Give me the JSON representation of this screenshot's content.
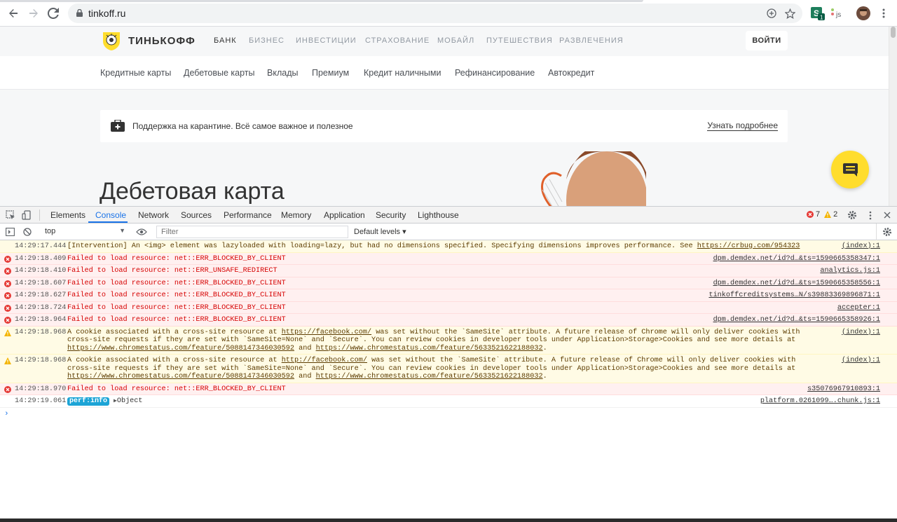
{
  "browser": {
    "url": "tinkoff.ru",
    "back_icon": "arrow-left-icon",
    "forward_icon": "arrow-right-icon",
    "reload_icon": "reload-icon",
    "extension_badge": "1",
    "extension_js_label": "js"
  },
  "site": {
    "brand": "ТИНЬКОФФ",
    "top_nav": [
      "БАНК",
      "БИЗНЕС",
      "ИНВЕСТИЦИИ",
      "СТРАХОВАНИЕ",
      "МОБАЙЛ",
      "ПУТЕШЕСТВИЯ",
      "РАЗВЛЕЧЕНИЯ"
    ],
    "login_label": "ВОЙТИ",
    "sub_nav": [
      "Кредитные карты",
      "Дебетовые карты",
      "Вклады",
      "Премиум",
      "Кредит наличными",
      "Рефинансирование",
      "Автокредит"
    ],
    "promo_text": "Поддержка на карантине. Всё самое важное и полезное",
    "promo_link": "Узнать подробнее",
    "heading": "Дебетовая карта",
    "accent_color": "#ffdd2d"
  },
  "devtools": {
    "tabs": [
      "Elements",
      "Console",
      "Network",
      "Sources",
      "Performance",
      "Memory",
      "Application",
      "Security",
      "Lighthouse"
    ],
    "active_tab": "Console",
    "error_count": "7",
    "warning_count": "2",
    "context": "top",
    "filter_placeholder": "Filter",
    "levels_label": "Default levels ▾",
    "messages": [
      {
        "type": "warn",
        "time": "14:29:17.444",
        "text": "[Intervention] An <img> element was lazyloaded with loading=lazy, but had no dimensions specified. Specifying dimensions improves performance. See ",
        "link": "https://crbug.com/954323",
        "source": "(index):1"
      },
      {
        "type": "err",
        "time": "14:29:18.409",
        "text": "Failed to load resource: net::ERR_BLOCKED_BY_CLIENT",
        "source": "dpm.demdex.net/id?d…&ts=1590665358347:1"
      },
      {
        "type": "err",
        "time": "14:29:18.410",
        "text": "Failed to load resource: net::ERR_UNSAFE_REDIRECT",
        "source": "analytics.js:1"
      },
      {
        "type": "err",
        "time": "14:29:18.607",
        "text": "Failed to load resource: net::ERR_BLOCKED_BY_CLIENT",
        "source": "dpm.demdex.net/id?d…&ts=1590665358556:1"
      },
      {
        "type": "err",
        "time": "14:29:18.627",
        "text": "Failed to load resource: net::ERR_BLOCKED_BY_CLIENT",
        "source": "tinkoffcreditsystems…N/s39883369896871:1"
      },
      {
        "type": "err",
        "time": "14:29:18.724",
        "text": "Failed to load resource: net::ERR_BLOCKED_BY_CLIENT",
        "source": "accepter:1"
      },
      {
        "type": "err",
        "time": "14:29:18.964",
        "text": "Failed to load resource: net::ERR_BLOCKED_BY_CLIENT",
        "source": "dpm.demdex.net/id?d…&ts=1590665358926:1"
      },
      {
        "type": "warn",
        "time": "14:29:18.968",
        "text1": "A cookie associated with a cross-site resource at ",
        "link1": "https://facebook.com/",
        "text2": " was set without the `SameSite` attribute. A future release of Chrome will only deliver cookies with cross-site requests if they are set with `SameSite=None` and `Secure`. You can review cookies in developer tools under Application>Storage>Cookies and see more details at ",
        "link2": "https://www.chromestatus.com/feature/5088147346030592",
        "text3": " and ",
        "link3": "https://www.chromestatus.com/feature/5633521622188032",
        "text4": ".",
        "source": "(index):1"
      },
      {
        "type": "warn",
        "time": "14:29:18.968",
        "text1": "A cookie associated with a cross-site resource at ",
        "link1": "http://facebook.com/",
        "text2": " was set without the `SameSite` attribute. A future release of Chrome will only deliver cookies with cross-site requests if they are set with `SameSite=None` and `Secure`. You can review cookies in developer tools under Application>Storage>Cookies and see more details at ",
        "link2": "https://www.chromestatus.com/feature/5088147346030592",
        "text3": " and ",
        "link3": "https://www.chromestatus.com/feature/5633521622188032",
        "text4": ".",
        "source": "(index):1"
      },
      {
        "type": "err",
        "time": "14:29:18.970",
        "text": "Failed to load resource: net::ERR_BLOCKED_BY_CLIENT",
        "source": "s35076967910893:1"
      },
      {
        "type": "info",
        "time": "14:29:19.061",
        "badge": "perf:info",
        "text": "Object",
        "source": "platform.0261099….chunk.js:1"
      }
    ],
    "prompt": "›"
  }
}
